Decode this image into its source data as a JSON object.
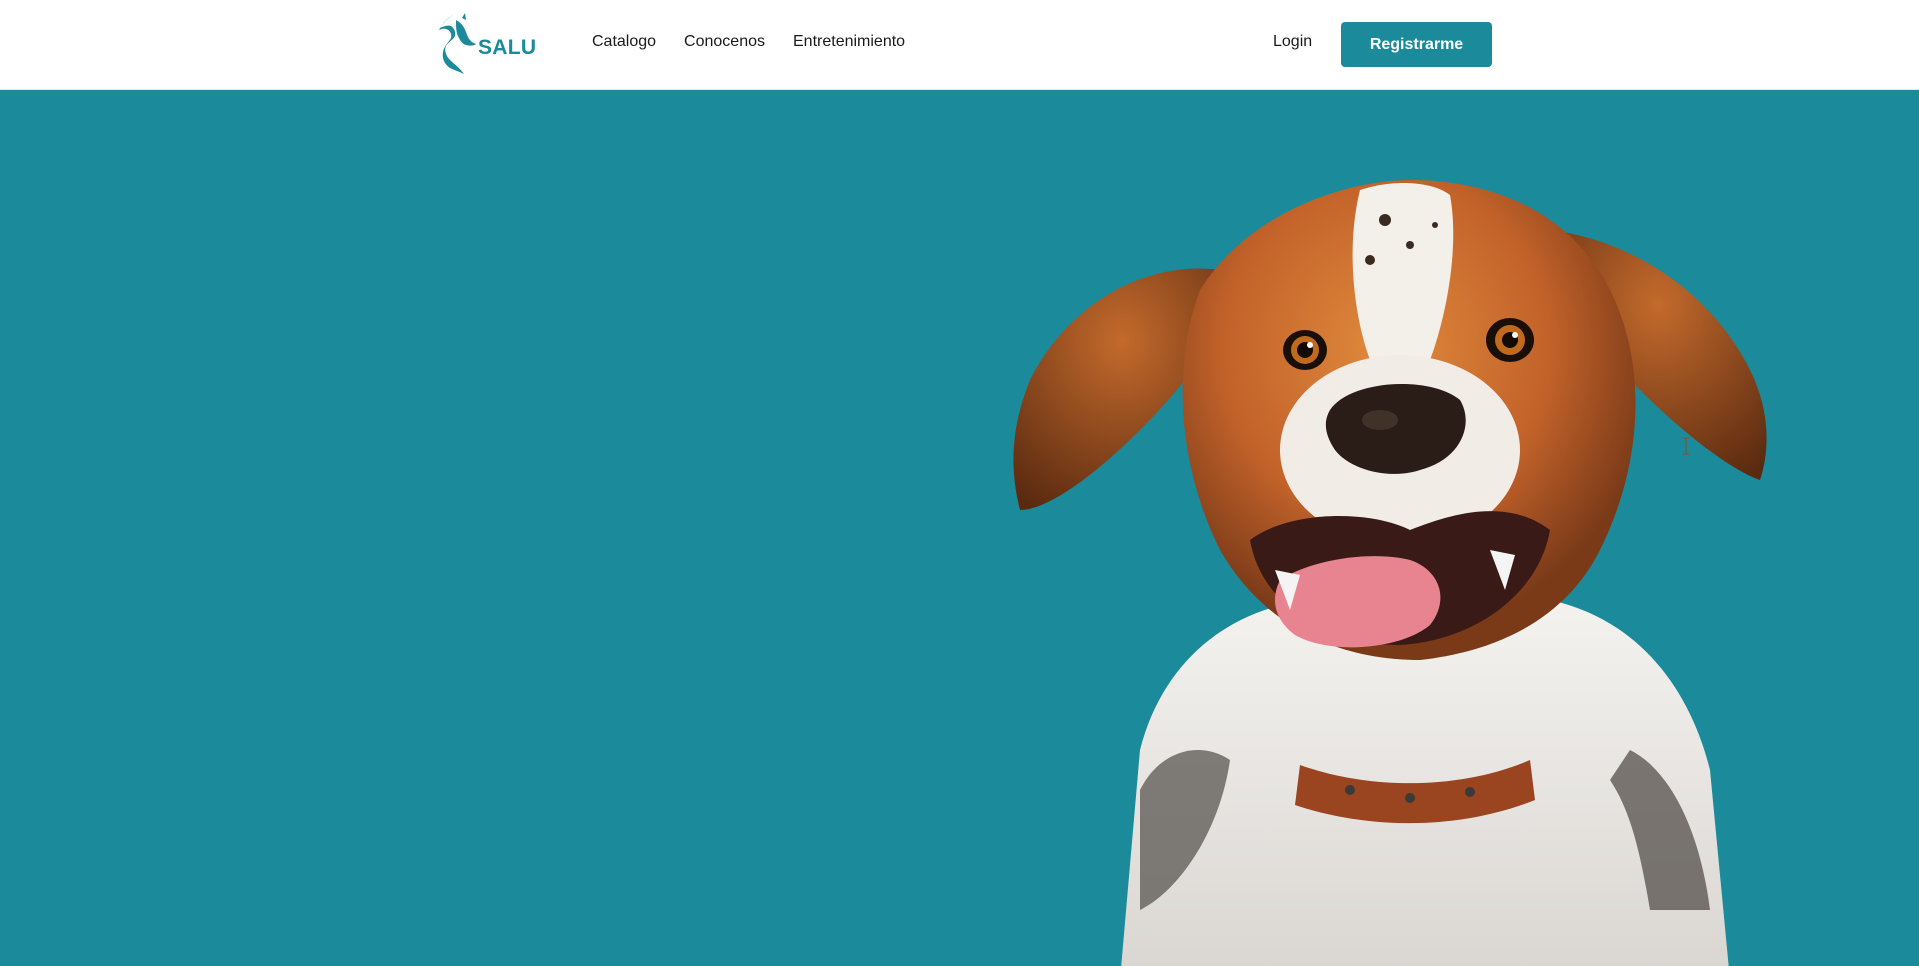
{
  "brand": {
    "name": "SALU",
    "logo_icon": "dog-cat-silhouette-icon",
    "color": "#1b8a9b"
  },
  "nav": {
    "links": [
      "Catalogo",
      "Conocenos",
      "Entretenimiento"
    ]
  },
  "auth": {
    "login_label": "Login",
    "register_label": "Registrarme"
  },
  "hero": {
    "background_color": "#1b8a9b",
    "image_subject": "happy-dog-photo"
  },
  "cursor": {
    "type": "text-cursor-icon"
  }
}
